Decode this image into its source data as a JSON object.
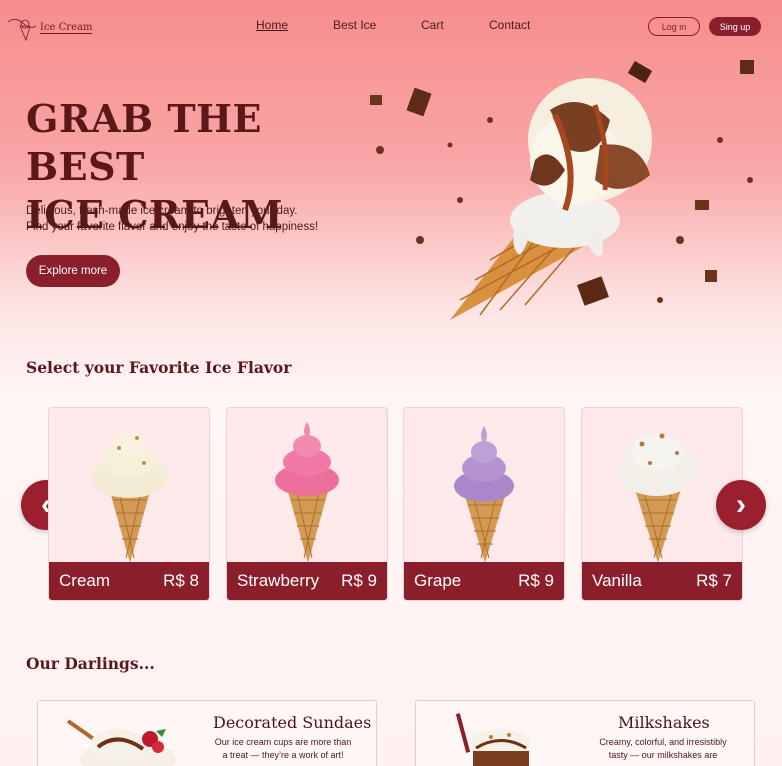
{
  "brand": {
    "name": "Ice Cream"
  },
  "nav": {
    "links": [
      "Home",
      "Best Ice",
      "Cart",
      "Contact"
    ],
    "login": "Log in",
    "signup": "Sing up"
  },
  "hero": {
    "title_line1": "GRAB THE BEST",
    "title_line2": "ICE CREAM",
    "desc_line1": "Delicious, fresh-made ice cream to brighten your day.",
    "desc_line2": "Find your favorite flavor and enjoy the taste of happiness!",
    "cta": "Explore more"
  },
  "flavors": {
    "title": "Select your Favorite Ice Flavor",
    "prev_icon": "chevron-left-icon",
    "next_icon": "chevron-right-icon",
    "items": [
      {
        "name": "Cream",
        "price": "R$ 8",
        "color": "#f3ecd2"
      },
      {
        "name": "Strawberry",
        "price": "R$ 9",
        "color": "#f07aa5"
      },
      {
        "name": "Grape",
        "price": "R$ 9",
        "color": "#b493d0"
      },
      {
        "name": "Vanilla",
        "price": "R$ 7",
        "color": "#f2efe9"
      }
    ]
  },
  "darlings": {
    "title": "Our Darlings...",
    "items": [
      {
        "title": "Decorated Sundaes",
        "line1": "Our ice cream cups are more than",
        "line2": "a treat — they’re a work of art!"
      },
      {
        "title": "Milkshakes",
        "line1": "Creamy, colorful, and irresistibly",
        "line2": "tasty — our milkshakes are"
      }
    ]
  },
  "colors": {
    "accent": "#8b1e2b",
    "text": "#5c1818"
  }
}
